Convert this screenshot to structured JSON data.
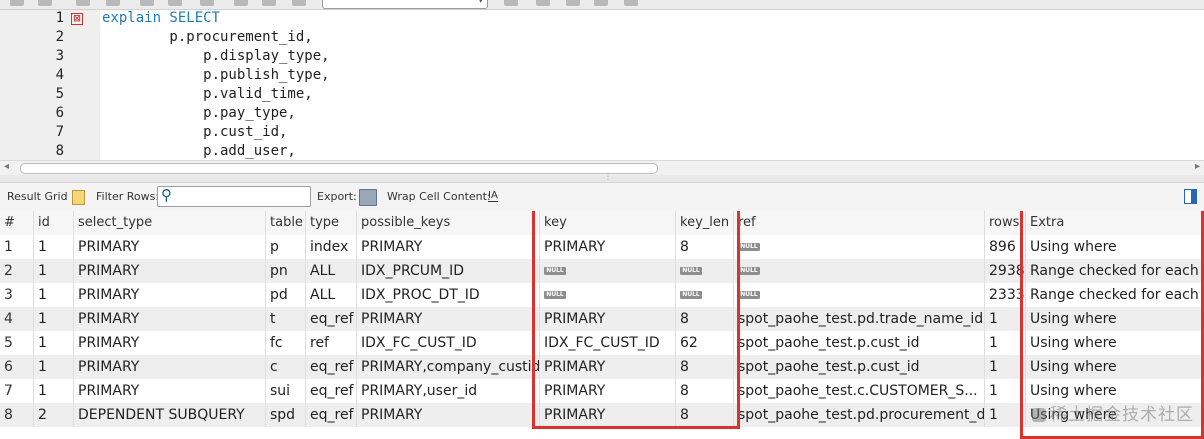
{
  "editor": {
    "fold_marker": "⊠",
    "lines": [
      {
        "num": "1",
        "keyword": "explain SELECT",
        "text": ""
      },
      {
        "num": "2",
        "keyword": "",
        "text": "        p.procurement_id,"
      },
      {
        "num": "3",
        "keyword": "",
        "text": "            p.display_type,"
      },
      {
        "num": "4",
        "keyword": "",
        "text": "            p.publish_type,"
      },
      {
        "num": "5",
        "keyword": "",
        "text": "            p.valid_time,"
      },
      {
        "num": "6",
        "keyword": "",
        "text": "            p.pay_type,"
      },
      {
        "num": "7",
        "keyword": "",
        "text": "            p.cust_id,"
      },
      {
        "num": "8",
        "keyword": "",
        "text": "            p.add_user,"
      }
    ]
  },
  "result_toolbar": {
    "result_grid_label": "Result Grid",
    "filter_rows_label": "Filter Rows:",
    "filter_value": "",
    "export_label": "Export:",
    "wrap_label": "Wrap Cell Content:",
    "wrap_icon_glyph": "IA"
  },
  "grid": {
    "null_label": "NULL",
    "columns": [
      "#",
      "id",
      "select_type",
      "table",
      "type",
      "possible_keys",
      "key",
      "key_len",
      "ref",
      "rows",
      "Extra"
    ],
    "rows": [
      [
        "1",
        "1",
        "PRIMARY",
        "p",
        "index",
        "PRIMARY",
        "PRIMARY",
        "8",
        null,
        "896",
        "Using where"
      ],
      [
        "2",
        "1",
        "PRIMARY",
        "pn",
        "ALL",
        "IDX_PRCUM_ID",
        null,
        null,
        null,
        "2938",
        "Range checked for each re"
      ],
      [
        "3",
        "1",
        "PRIMARY",
        "pd",
        "ALL",
        "IDX_PROC_DT_ID",
        null,
        null,
        null,
        "2333",
        "Range checked for each re"
      ],
      [
        "4",
        "1",
        "PRIMARY",
        "t",
        "eq_ref",
        "PRIMARY",
        "PRIMARY",
        "8",
        "spot_paohe_test.pd.trade_name_id",
        "1",
        "Using where"
      ],
      [
        "5",
        "1",
        "PRIMARY",
        "fc",
        "ref",
        "IDX_FC_CUST_ID",
        "IDX_FC_CUST_ID",
        "62",
        "spot_paohe_test.p.cust_id",
        "1",
        "Using where"
      ],
      [
        "6",
        "1",
        "PRIMARY",
        "c",
        "eq_ref",
        "PRIMARY,company_custid",
        "PRIMARY",
        "8",
        "spot_paohe_test.p.cust_id",
        "1",
        "Using where"
      ],
      [
        "7",
        "1",
        "PRIMARY",
        "sui",
        "eq_ref",
        "PRIMARY,user_id",
        "PRIMARY",
        "8",
        "spot_paohe_test.c.CUSTOMER_S...",
        "1",
        "Using where"
      ],
      [
        "8",
        "2",
        "DEPENDENT SUBQUERY",
        "spd",
        "eq_ref",
        "PRIMARY",
        "PRIMARY",
        "8",
        "spot_paohe_test.pd.procurement_d...",
        "1",
        "Using where"
      ]
    ]
  },
  "annotations": {
    "highlight_color": "#d9332e"
  },
  "watermark": {
    "text": "稀土掘金技术社区"
  },
  "colors": {
    "keyword": "#1f7ab8",
    "row_alt": "#eeeeee"
  }
}
